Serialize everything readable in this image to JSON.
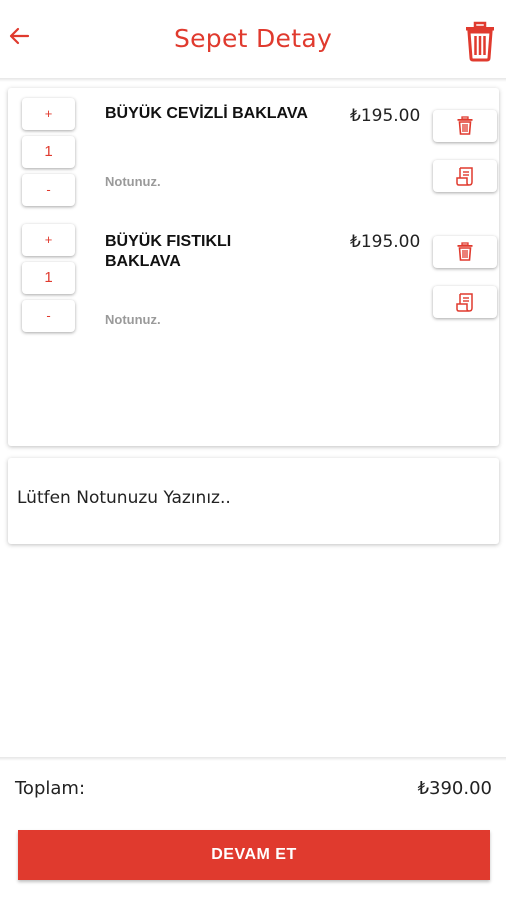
{
  "header": {
    "title": "Sepet Detay",
    "back_icon": "arrow-left-icon",
    "clear_icon": "trash-icon"
  },
  "colors": {
    "accent": "#e03a2e",
    "note_gray": "#9a9a9a"
  },
  "items": [
    {
      "name_lines": [
        "BÜYÜK CEVİZLİ BAKLAVA"
      ],
      "price": "₺195.00",
      "quantity": "1",
      "plus": "+",
      "minus": "-",
      "note": "Notunuz."
    },
    {
      "name_lines": [
        "BÜYÜK FISTIKLI",
        "BAKLAVA"
      ],
      "price": "₺195.00",
      "quantity": "1",
      "plus": "+",
      "minus": "-",
      "note": "Notunuz."
    }
  ],
  "order_note": {
    "placeholder": "Lütfen Notunuzu Yazınız.."
  },
  "footer": {
    "total_label": "Toplam:",
    "total_value": "₺390.00",
    "continue_label": "DEVAM ET"
  }
}
